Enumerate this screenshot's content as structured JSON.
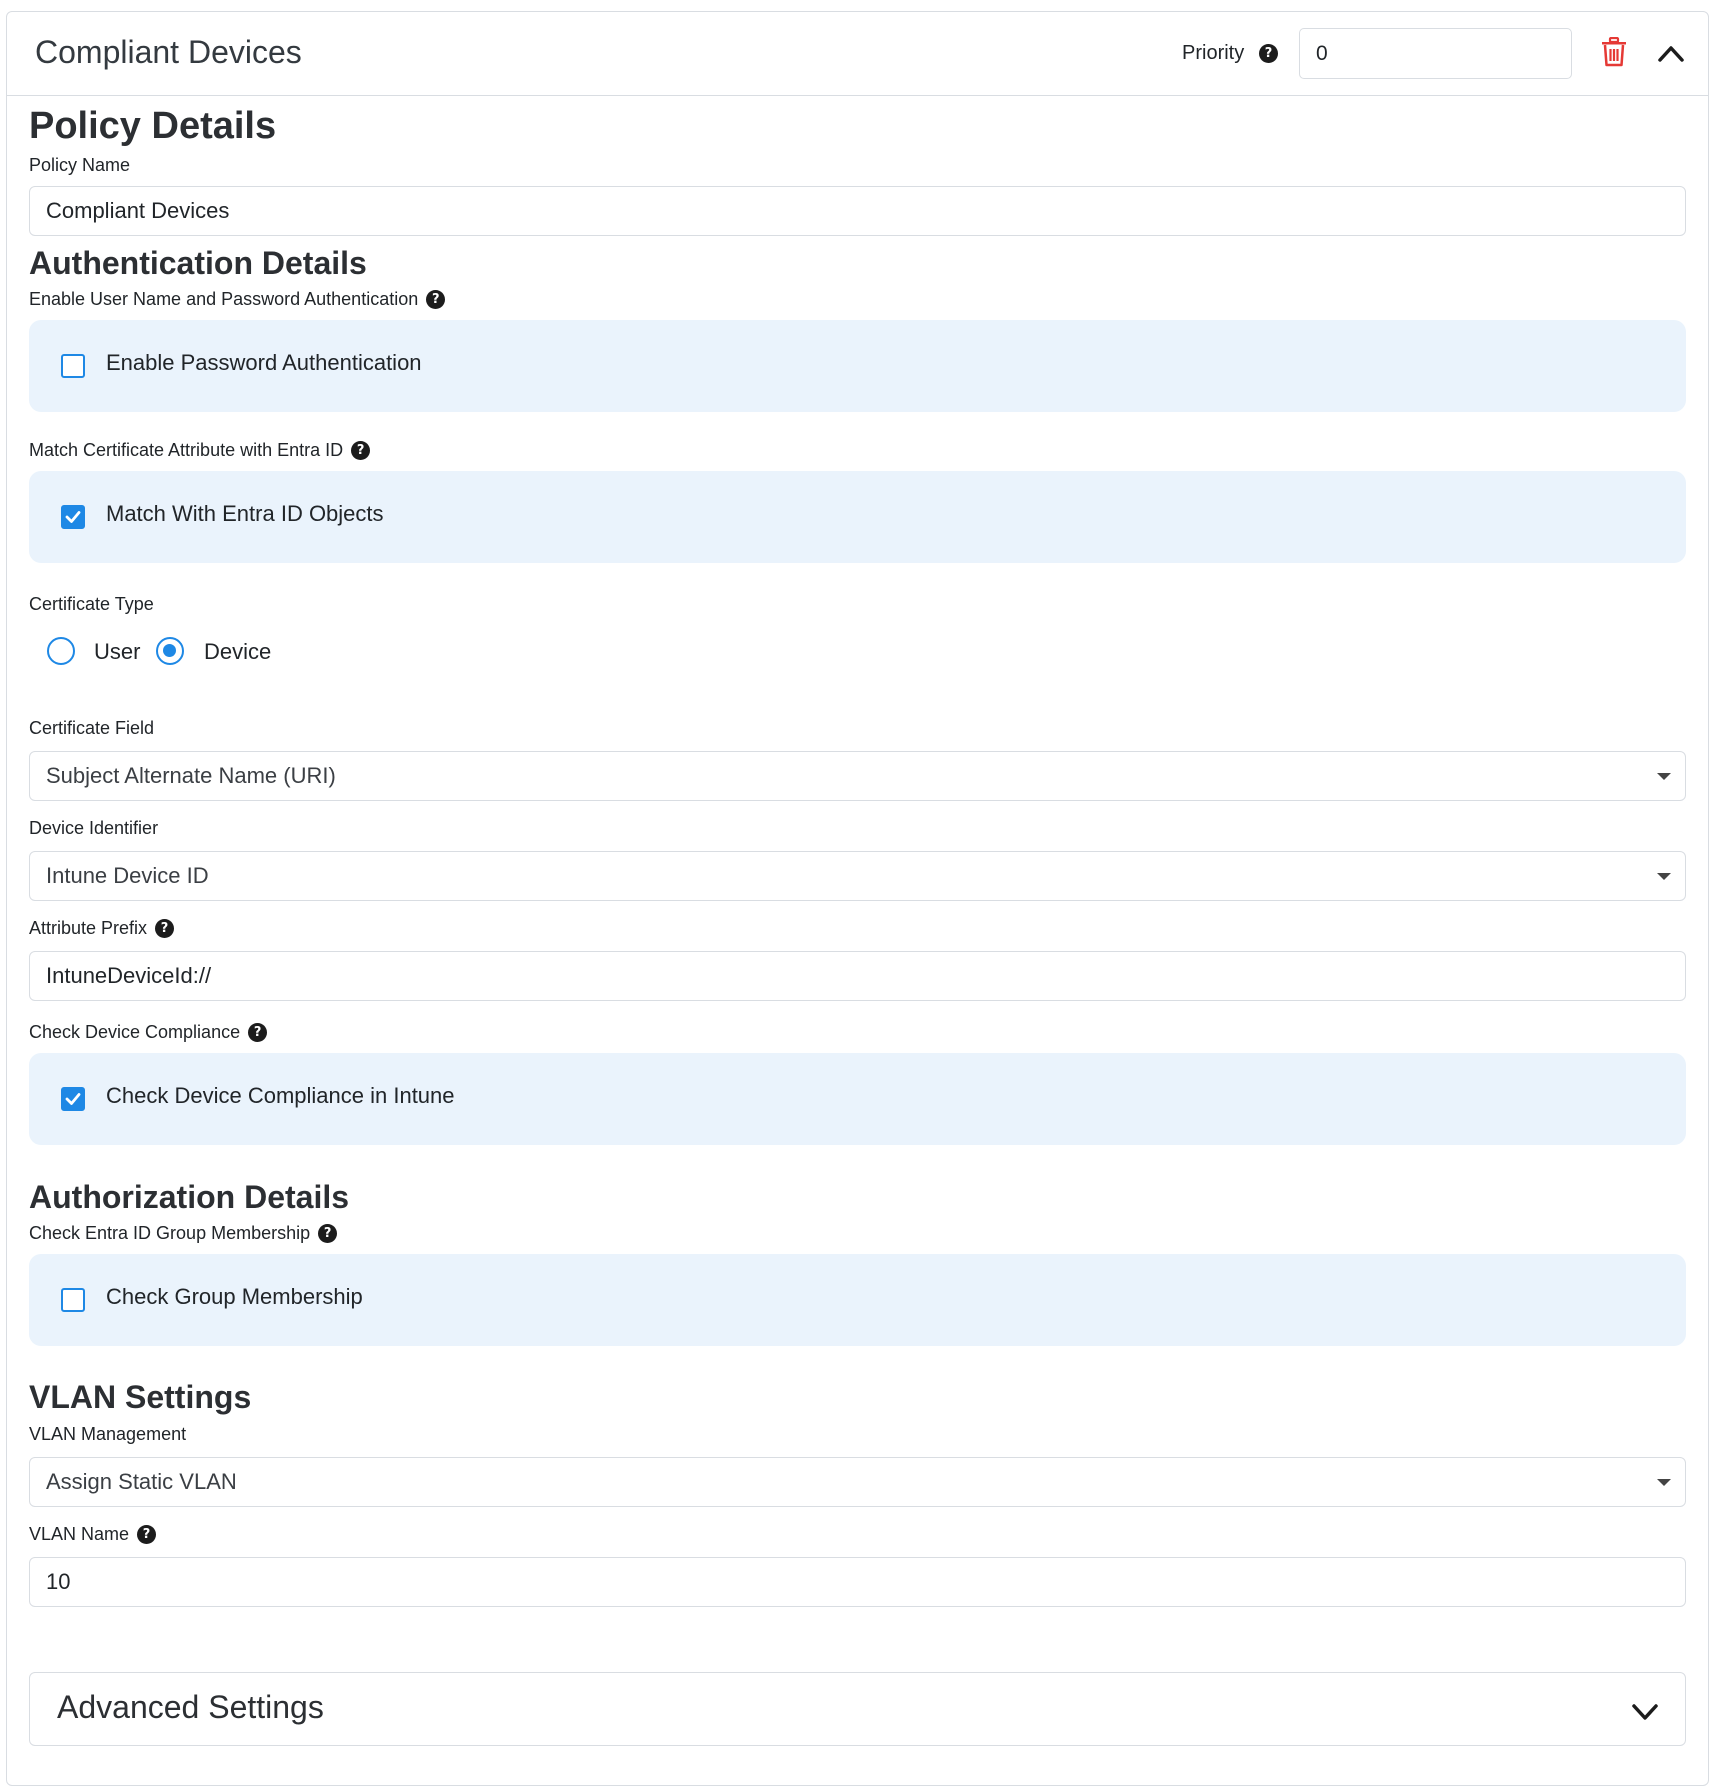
{
  "header": {
    "title": "Compliant Devices",
    "priority_label": "Priority",
    "priority_value": "0",
    "delete_icon": "trash-icon",
    "collapse_icon": "chevron-up-icon"
  },
  "policy_details": {
    "heading": "Policy Details",
    "policy_name_label": "Policy Name",
    "policy_name_value": "Compliant Devices"
  },
  "authentication": {
    "heading": "Authentication Details",
    "password_label": "Enable User Name and Password Authentication",
    "password_checkbox_label": "Enable Password Authentication",
    "password_checked": false,
    "match_label": "Match Certificate Attribute with Entra ID",
    "match_checkbox_label": "Match With Entra ID Objects",
    "match_checked": true,
    "cert_type_label": "Certificate Type",
    "cert_type_options": [
      "User",
      "Device"
    ],
    "cert_type_selected": "Device",
    "cert_field_label": "Certificate Field",
    "cert_field_value": "Subject Alternate Name (URI)",
    "device_identifier_label": "Device Identifier",
    "device_identifier_value": "Intune Device ID",
    "attribute_prefix_label": "Attribute Prefix",
    "attribute_prefix_value": "IntuneDeviceId://",
    "compliance_label": "Check Device Compliance",
    "compliance_checkbox_label": "Check Device Compliance in Intune",
    "compliance_checked": true
  },
  "authorization": {
    "heading": "Authorization Details",
    "group_label": "Check Entra ID Group Membership",
    "group_checkbox_label": "Check Group Membership",
    "group_checked": false
  },
  "vlan": {
    "heading": "VLAN Settings",
    "management_label": "VLAN Management",
    "management_value": "Assign Static VLAN",
    "name_label": "VLAN Name",
    "name_value": "10"
  },
  "advanced": {
    "title": "Advanced Settings",
    "expand_icon": "chevron-down-icon"
  },
  "colors": {
    "accent": "#1e88e5",
    "panel_bg": "#eaf3fc",
    "delete": "#e53935",
    "border": "#d9dde2"
  }
}
